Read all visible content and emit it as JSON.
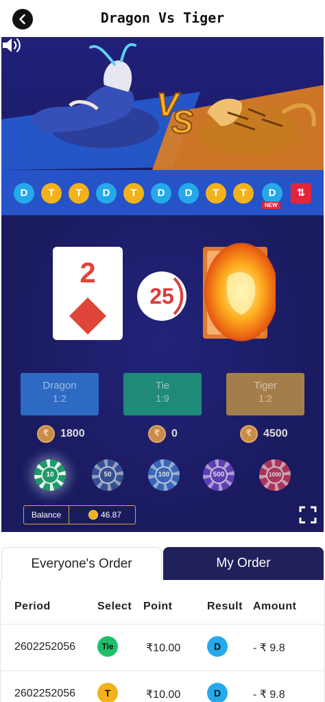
{
  "header": {
    "title": "Dragon Vs Tiger"
  },
  "history": [
    "D",
    "T",
    "T",
    "D",
    "T",
    "D",
    "D",
    "T",
    "T",
    "D"
  ],
  "history_new_tag": "NEW",
  "history_sort_label": "⇅",
  "card_left": {
    "rank": "2",
    "suit": "diamond"
  },
  "timer": "25",
  "bets": {
    "dragon": {
      "name": "Dragon",
      "odds": "1:2",
      "pot": "1800"
    },
    "tie": {
      "name": "Tie",
      "odds": "1:9",
      "pot": "0"
    },
    "tiger": {
      "name": "Tiger",
      "odds": "1:2",
      "pot": "4500"
    }
  },
  "coin_symbol": "₹",
  "chips": [
    "10",
    "50",
    "100",
    "500",
    "1000"
  ],
  "selected_chip": "10",
  "balance": {
    "label": "Balance",
    "value": "46.87"
  },
  "tabs": {
    "everyone": "Everyone's Order",
    "mine": "My Order"
  },
  "orders": {
    "columns": [
      "Period",
      "Select",
      "Point",
      "Result",
      "Amount"
    ],
    "rows": [
      {
        "period": "2602252056",
        "select": "Tie",
        "point": "₹10.00",
        "result": "D",
        "amount": "- ₹ 9.8"
      },
      {
        "period": "2602252056",
        "select": "T",
        "point": "₹10.00",
        "result": "D",
        "amount": "- ₹ 9.8"
      }
    ]
  },
  "colors": {
    "game_bg": "#1a1a5e",
    "dragon_bead": "#25a9ea",
    "tiger_bead": "#f2b21b",
    "tie_badge": "#1fbf6a",
    "accent_red": "#e3253c"
  }
}
